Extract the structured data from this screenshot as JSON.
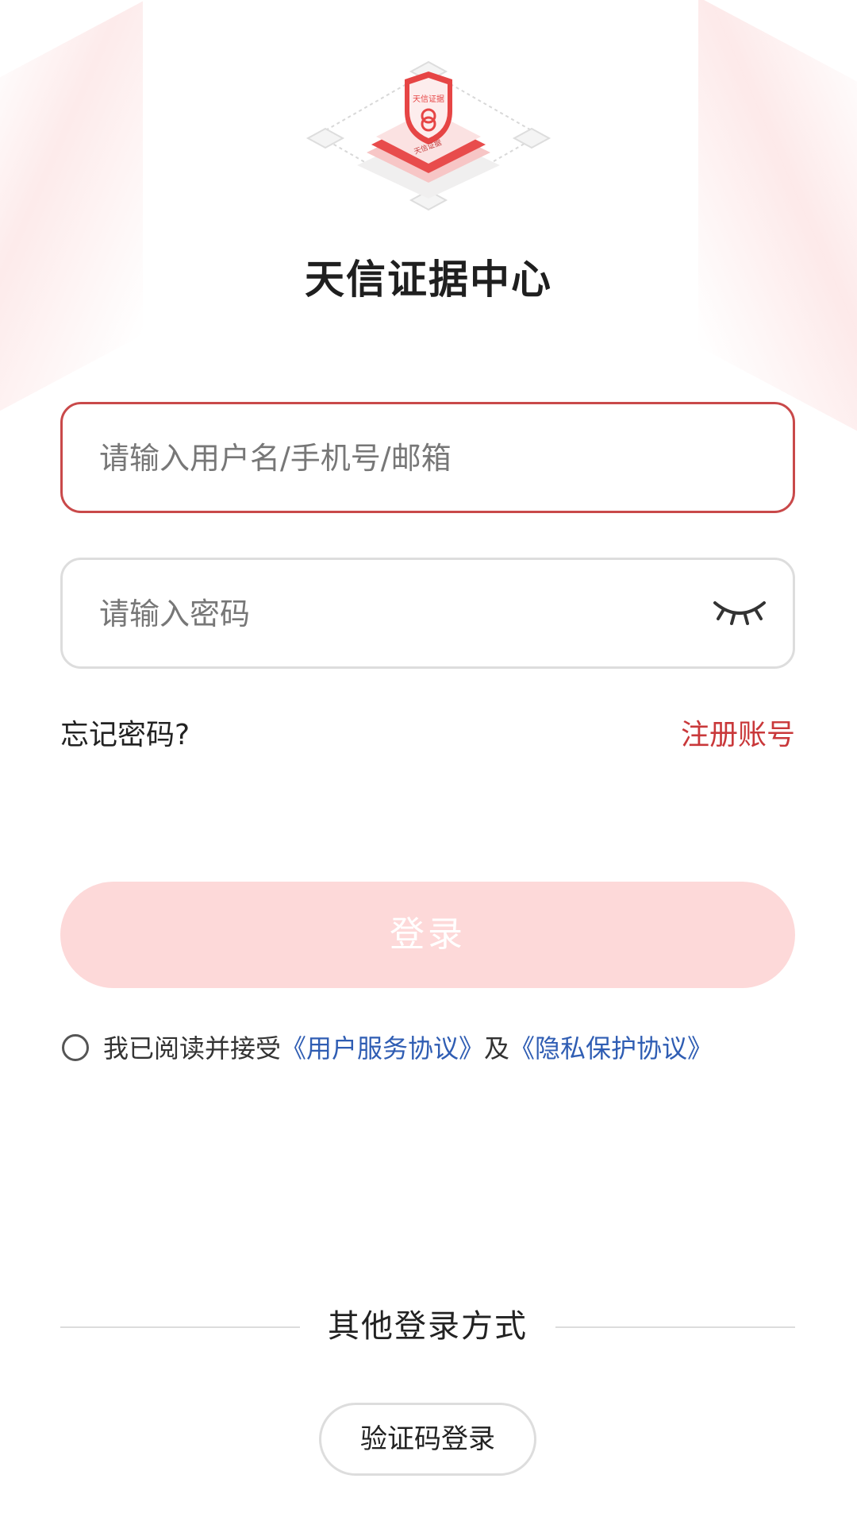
{
  "app": {
    "title": "天信证据中心",
    "logo_text": [
      "天信证据",
      "天信证据"
    ]
  },
  "login_form": {
    "username_placeholder": "请输入用户名/手机号/邮箱",
    "password_placeholder": "请输入密码",
    "password_toggle_icon": "eye-closed-icon",
    "forgot_password": "忘记密码?",
    "register": "注册账号",
    "submit": "登录"
  },
  "agreement": {
    "prefix": "我已阅读并接受",
    "user_agreement": "《用户服务协议》",
    "conjunction": "及",
    "privacy_agreement": "《隐私保护协议》",
    "checked": false
  },
  "other_login": {
    "label": "其他登录方式",
    "sms_login": "验证码登录"
  },
  "colors": {
    "accent": "#c9383a",
    "link": "#2f5db3",
    "button_disabled": "#fdd9d9"
  }
}
